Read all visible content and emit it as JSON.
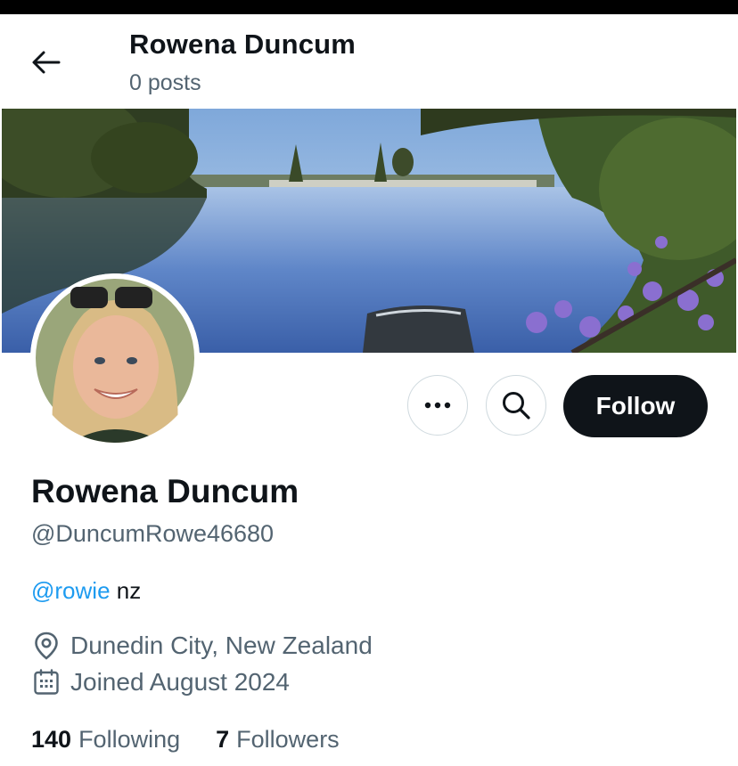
{
  "header": {
    "title": "Rowena Duncum",
    "subtitle": "0 posts"
  },
  "profile": {
    "display_name": "Rowena Duncum",
    "handle": "@DuncumRowe46680",
    "bio_mention": "@rowie",
    "bio_text": " nz",
    "location": "Dunedin City, New Zealand",
    "joined": "Joined August 2024"
  },
  "actions": {
    "follow_label": "Follow"
  },
  "stats": {
    "following_count": "140",
    "following_label": "Following",
    "followers_count": "7",
    "followers_label": "Followers"
  },
  "icons": {
    "back": "arrow-left-icon",
    "more": "ellipsis-icon",
    "search": "search-icon",
    "location": "location-pin-icon",
    "calendar": "calendar-icon"
  },
  "colors": {
    "link": "#1d9bf0",
    "primary_text": "#0f1419",
    "secondary_text": "#536471",
    "follow_bg": "#0f1419"
  }
}
